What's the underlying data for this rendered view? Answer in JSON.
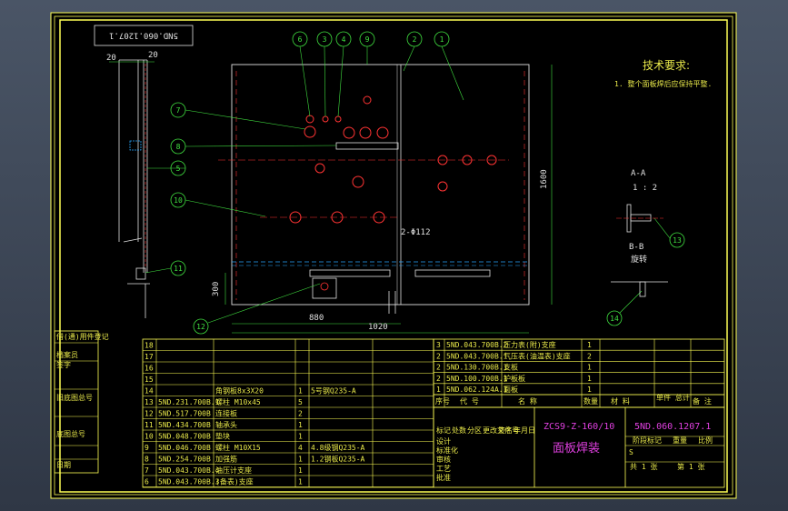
{
  "drawing_number_box": "5ND.060.1207.1",
  "tech_requirements": {
    "title": "技术要求:",
    "items": [
      "1. 整个面板焊后应保持平整."
    ]
  },
  "section_labels": {
    "aa": "A-A",
    "scale": "1 : 2",
    "bb": "B-B",
    "bb_sub": "旋转"
  },
  "callouts": [
    "1",
    "2",
    "3",
    "4",
    "5",
    "6",
    "7",
    "8",
    "9",
    "10",
    "11",
    "12",
    "13",
    "14"
  ],
  "dimensions": {
    "overall_width": "1020",
    "inner_width": "880",
    "height": "1600",
    "left_top": "20",
    "right_top": "20",
    "bottom_height": "300",
    "hole_label": "2-Φ112"
  },
  "bom_parts_right": [
    {
      "no": "3",
      "code": "5ND.043.700B.2",
      "name": "压力表(附)支座",
      "qty": "1"
    },
    {
      "no": "2",
      "code": "5ND.043.700B.1",
      "name": "气压表(油温表)支座",
      "qty": "2"
    },
    {
      "no": "2",
      "code": "5ND.130.700B.1",
      "name": "支板",
      "qty": "1"
    },
    {
      "no": "2",
      "code": "5ND.100.700B.1",
      "name": "护板板",
      "qty": "1"
    },
    {
      "no": "1",
      "code": "5ND.062.124A.1",
      "name": "面板",
      "qty": "1"
    }
  ],
  "bom_header": {
    "no": "序号",
    "code": "代    号",
    "name": "名        称",
    "qty": "数量",
    "material": "材    料",
    "unit_weight": "单件 总计",
    "weight": "重量",
    "remark": "备    注"
  },
  "bom_parts_left": [
    {
      "no": "18",
      "code": "",
      "name": "",
      "qty": "",
      "material": ""
    },
    {
      "no": "17",
      "code": "",
      "name": "",
      "qty": "",
      "material": ""
    },
    {
      "no": "16",
      "code": "",
      "name": "",
      "qty": "",
      "material": ""
    },
    {
      "no": "15",
      "code": "",
      "name": "",
      "qty": "",
      "material": ""
    },
    {
      "no": "14",
      "code": "",
      "name": "角钢板8x3X20",
      "qty": "1",
      "material": "5号钢Q235-A"
    },
    {
      "no": "13",
      "code": "5ND.231.700B.1",
      "name": "螺柱 M10x45",
      "qty": "5",
      "material": ""
    },
    {
      "no": "12",
      "code": "5ND.517.700B",
      "name": "连接板",
      "qty": "2",
      "material": ""
    },
    {
      "no": "11",
      "code": "5ND.434.700B",
      "name": "轴承头",
      "qty": "1",
      "material": ""
    },
    {
      "no": "10",
      "code": "5ND.048.700B",
      "name": "垫块",
      "qty": "1",
      "material": ""
    },
    {
      "no": "9",
      "code": "5ND.046.700B",
      "name": "螺柱 M10X15",
      "qty": "4",
      "material": "4.8级钢Q235-A"
    },
    {
      "no": "8",
      "code": "5ND.254.700B",
      "name": "加强筋",
      "qty": "1",
      "material": "1.2钢板Q235-A"
    },
    {
      "no": "7",
      "code": "5ND.043.700B.4",
      "name": "油压计支座",
      "qty": "1",
      "material": ""
    },
    {
      "no": "6",
      "code": "5ND.043.700B.3",
      "name": "(备表)支座",
      "qty": "1",
      "material": ""
    }
  ],
  "title_block": {
    "product_code": "ZCS9-Z-160/10",
    "part_name": "面板焊装",
    "drawing_number": "5ND.060.1207.1",
    "stage_label": "阶段标记",
    "weight_label": "重量",
    "scale_label": "比例",
    "sheet_total": "共  1  张",
    "sheet_no": "第  1  张",
    "stage_mark": "S",
    "labels": [
      "标记",
      "处数",
      "分区",
      "更改文件号",
      "签名",
      "年月日",
      "设计",
      "标准化",
      "审核",
      "工艺",
      "批准"
    ]
  },
  "side_labels": [
    "借(通)用件登记",
    "旧底图总号",
    "底图总号",
    "签字",
    "日期",
    "档案员"
  ],
  "colors": {
    "frame": "#ffff55",
    "outline": "#ffffff",
    "leader": "#3cff3c",
    "center": "#ff3333",
    "hidden": "#29a7ff",
    "title_magenta": "#e040e0",
    "background": "#000000"
  }
}
